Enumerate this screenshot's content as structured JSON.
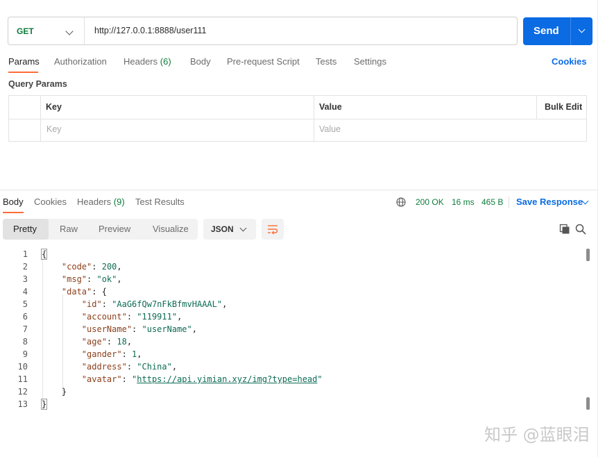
{
  "request": {
    "method": "GET",
    "url": "http://127.0.0.1:8888/user111",
    "send_label": "Send"
  },
  "request_tabs": [
    {
      "label": "Params",
      "count": ""
    },
    {
      "label": "Authorization",
      "count": ""
    },
    {
      "label": "Headers",
      "count": "(6)"
    },
    {
      "label": "Body",
      "count": ""
    },
    {
      "label": "Pre-request Script",
      "count": ""
    },
    {
      "label": "Tests",
      "count": ""
    },
    {
      "label": "Settings",
      "count": ""
    }
  ],
  "cookies_link": "Cookies",
  "query_params": {
    "title": "Query Params",
    "columns": [
      "Key",
      "Value",
      "Bulk Edit"
    ],
    "placeholders": {
      "key": "Key",
      "value": "Value"
    }
  },
  "response_tabs": [
    {
      "label": "Body",
      "count": ""
    },
    {
      "label": "Cookies",
      "count": ""
    },
    {
      "label": "Headers",
      "count": "(9)"
    },
    {
      "label": "Test Results",
      "count": ""
    }
  ],
  "response_meta": {
    "status": "200 OK",
    "time": "16 ms",
    "size": "465 B",
    "save_label": "Save Response"
  },
  "view_modes": [
    "Pretty",
    "Raw",
    "Preview",
    "Visualize"
  ],
  "format": "JSON",
  "code_lines": [
    {
      "num": "1",
      "text": "{"
    },
    {
      "num": "2",
      "text": "    \"code\": 200,"
    },
    {
      "num": "3",
      "text": "    \"msg\": \"ok\","
    },
    {
      "num": "4",
      "text": "    \"data\": {"
    },
    {
      "num": "5",
      "text": "        \"id\": \"AaG6fQw7nFkBfmvHAAAL\","
    },
    {
      "num": "6",
      "text": "        \"account\": \"119911\","
    },
    {
      "num": "7",
      "text": "        \"userName\": \"userName\","
    },
    {
      "num": "8",
      "text": "        \"age\": 18,"
    },
    {
      "num": "9",
      "text": "        \"gander\": 1,"
    },
    {
      "num": "10",
      "text": "        \"address\": \"China\","
    },
    {
      "num": "11",
      "text": "        \"avatar\": \"https://api.yimian.xyz/img?type=head\""
    },
    {
      "num": "12",
      "text": "    }"
    },
    {
      "num": "13",
      "text": "}"
    }
  ],
  "watermark": "知乎 @蓝眼泪",
  "colors": {
    "accent": "#0a6be3",
    "tab_indicator": "#ff6c37",
    "status_green": "#0c7c3b"
  }
}
